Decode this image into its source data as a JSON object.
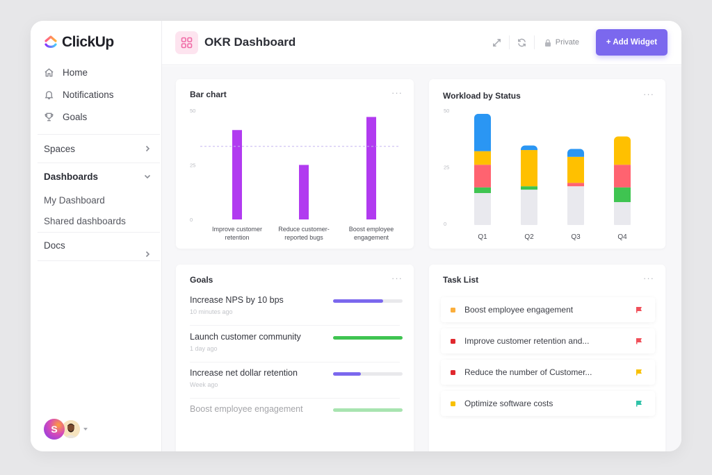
{
  "app": {
    "brand": "ClickUp",
    "brand_colors": {
      "accent": "#7b68ee",
      "logo_gradient": [
        "#ff5a8c",
        "#ffb13b",
        "#7b68ee",
        "#49ccf9"
      ]
    }
  },
  "sidebar": {
    "nav": [
      {
        "label": "Home",
        "icon": "home-icon"
      },
      {
        "label": "Notifications",
        "icon": "bell-icon"
      },
      {
        "label": "Goals",
        "icon": "trophy-icon"
      }
    ],
    "spaces": {
      "label": "Spaces",
      "icon": "chevron-right-icon"
    },
    "dashboards": {
      "label": "Dashboards",
      "icon": "chevron-down-icon",
      "items": [
        {
          "label": "My Dashboard"
        },
        {
          "label": "Shared dashboards"
        }
      ]
    },
    "docs": {
      "label": "Docs",
      "icon": "chevron-right-icon"
    },
    "user": {
      "initial": "S",
      "avatar_icon": "user-photo-avatar",
      "menu_icon": "caret-down-icon"
    }
  },
  "header": {
    "icon": "dashboard-grid-icon",
    "title": "OKR Dashboard",
    "tools": [
      {
        "icon": "expand-icon"
      },
      {
        "icon": "refresh-icon"
      }
    ],
    "privacy": {
      "icon": "lock-icon",
      "label": "Private"
    },
    "add_widget_label": "+ Add Widget"
  },
  "widgets": {
    "bar_chart": {
      "title": "Bar chart",
      "menu": "···"
    },
    "workload": {
      "title": "Workload by Status",
      "menu": "···"
    },
    "goals": {
      "title": "Goals",
      "menu": "···",
      "items": [
        {
          "name": "Increase NPS by 10 bps",
          "time": "10 minutes ago",
          "progress": 0.72,
          "color": "#7b68ee"
        },
        {
          "name": "Launch customer community",
          "time": "1 day ago",
          "progress": 1.0,
          "color": "#3fc451"
        },
        {
          "name": "Increase net dollar retention",
          "time": "Week ago",
          "progress": 0.4,
          "color": "#7b68ee"
        },
        {
          "name": "Boost employee engagement",
          "time": "",
          "progress": 1.0,
          "color": "#3fc451"
        }
      ]
    },
    "tasks": {
      "title": "Task List",
      "menu": "···",
      "items": [
        {
          "name": "Boost employee engagement",
          "status_color": "#fbae3c",
          "flag_color": "#f0505a",
          "flag_icon": "flag-icon"
        },
        {
          "name": "Improve customer retention and...",
          "status_color": "#e0282e",
          "flag_color": "#f0505a",
          "flag_icon": "flag-icon"
        },
        {
          "name": "Reduce the number of Customer...",
          "status_color": "#e0282e",
          "flag_color": "#f8c000",
          "flag_icon": "flag-icon"
        },
        {
          "name": "Optimize software costs",
          "status_color": "#f8c000",
          "flag_color": "#2fc2a8",
          "flag_icon": "flag-icon"
        }
      ]
    }
  },
  "chart_data": [
    {
      "type": "bar",
      "title": "Bar chart",
      "categories": [
        [
          "Improve customer",
          "retention"
        ],
        [
          "Reduce customer-",
          "reported bugs"
        ],
        [
          "Boost employee",
          "engagement"
        ]
      ],
      "values": [
        41,
        25,
        47
      ],
      "target_line": 33.5,
      "ylim": [
        0,
        50
      ],
      "yticks": [
        0,
        25,
        50
      ],
      "xlabel": "",
      "ylabel": "",
      "grid": false,
      "bar_color": "#b13bf0",
      "target_color": "#c6b5f0"
    },
    {
      "type": "bar",
      "stacked": true,
      "title": "Workload by Status",
      "categories": [
        "Q1",
        "Q2",
        "Q3",
        "Q4"
      ],
      "series": [
        {
          "name": "Gray",
          "color": "#e9e9ee",
          "values": [
            13.5,
            15,
            16.5,
            9.5
          ]
        },
        {
          "name": "Green",
          "color": "#3fc451",
          "values": [
            2.5,
            1.5,
            0,
            6.5
          ]
        },
        {
          "name": "Red",
          "color": "#ff6370",
          "values": [
            10,
            0,
            1.5,
            10
          ]
        },
        {
          "name": "Yellow",
          "color": "#ffc000",
          "values": [
            6,
            16,
            11.5,
            12.5
          ]
        },
        {
          "name": "Blue",
          "color": "#2a96f3",
          "values": [
            16.5,
            2,
            3.5,
            0
          ]
        }
      ],
      "ylim": [
        0,
        50
      ],
      "yticks": [
        0,
        25,
        50
      ],
      "xlabel": "",
      "ylabel": "",
      "grid": false,
      "legend": "none"
    }
  ]
}
